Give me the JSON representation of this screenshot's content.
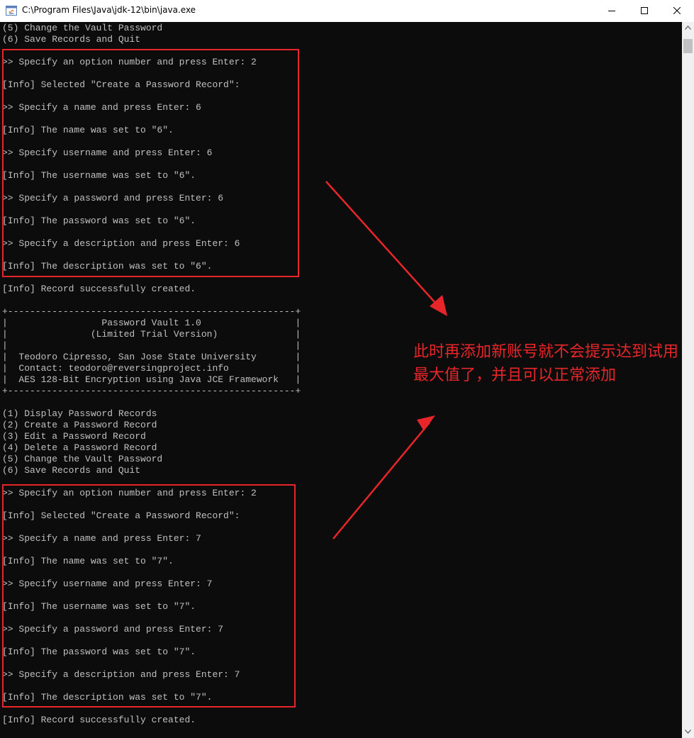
{
  "window": {
    "title": "C:\\Program Files\\Java\\jdk-12\\bin\\java.exe",
    "icon": "java-icon",
    "controls": [
      "minimize-icon",
      "maximize-icon",
      "close-icon"
    ]
  },
  "console": {
    "lines": [
      "(5) Change the Vault Password",
      "(6) Save Records and Quit",
      "",
      ">> Specify an option number and press Enter: 2",
      "",
      "[Info] Selected \"Create a Password Record\":",
      "",
      ">> Specify a name and press Enter: 6",
      "",
      "[Info] The name was set to \"6\".",
      "",
      ">> Specify username and press Enter: 6",
      "",
      "[Info] The username was set to \"6\".",
      "",
      ">> Specify a password and press Enter: 6",
      "",
      "[Info] The password was set to \"6\".",
      "",
      ">> Specify a description and press Enter: 6",
      "",
      "[Info] The description was set to \"6\".",
      "",
      "[Info] Record successfully created.",
      "",
      "+----------------------------------------------------+",
      "|                 Password Vault 1.0                 |",
      "|               (Limited Trial Version)              |",
      "|                                                    |",
      "|  Teodoro Cipresso, San Jose State University       |",
      "|  Contact: teodoro@reversingproject.info            |",
      "|  AES 128-Bit Encryption using Java JCE Framework   |",
      "+----------------------------------------------------+",
      "",
      "(1) Display Password Records",
      "(2) Create a Password Record",
      "(3) Edit a Password Record",
      "(4) Delete a Password Record",
      "(5) Change the Vault Password",
      "(6) Save Records and Quit",
      "",
      ">> Specify an option number and press Enter: 2",
      "",
      "[Info] Selected \"Create a Password Record\":",
      "",
      ">> Specify a name and press Enter: 7",
      "",
      "[Info] The name was set to \"7\".",
      "",
      ">> Specify username and press Enter: 7",
      "",
      "[Info] The username was set to \"7\".",
      "",
      ">> Specify a password and press Enter: 7",
      "",
      "[Info] The password was set to \"7\".",
      "",
      ">> Specify a description and press Enter: 7",
      "",
      "[Info] The description was set to \"7\".",
      "",
      "[Info] Record successfully created."
    ]
  },
  "annotation": {
    "text": "此时再添加新账号就不会提示达到试用最大值了，并且可以正常添加",
    "color": "#e8262a"
  },
  "colors": {
    "console_bg": "#0c0c0c",
    "console_fg": "#c0c0c0",
    "highlight": "#e8262a"
  },
  "scrollbar": {
    "icons": [
      "scroll-up-arrow-icon",
      "scroll-down-arrow-icon"
    ]
  }
}
